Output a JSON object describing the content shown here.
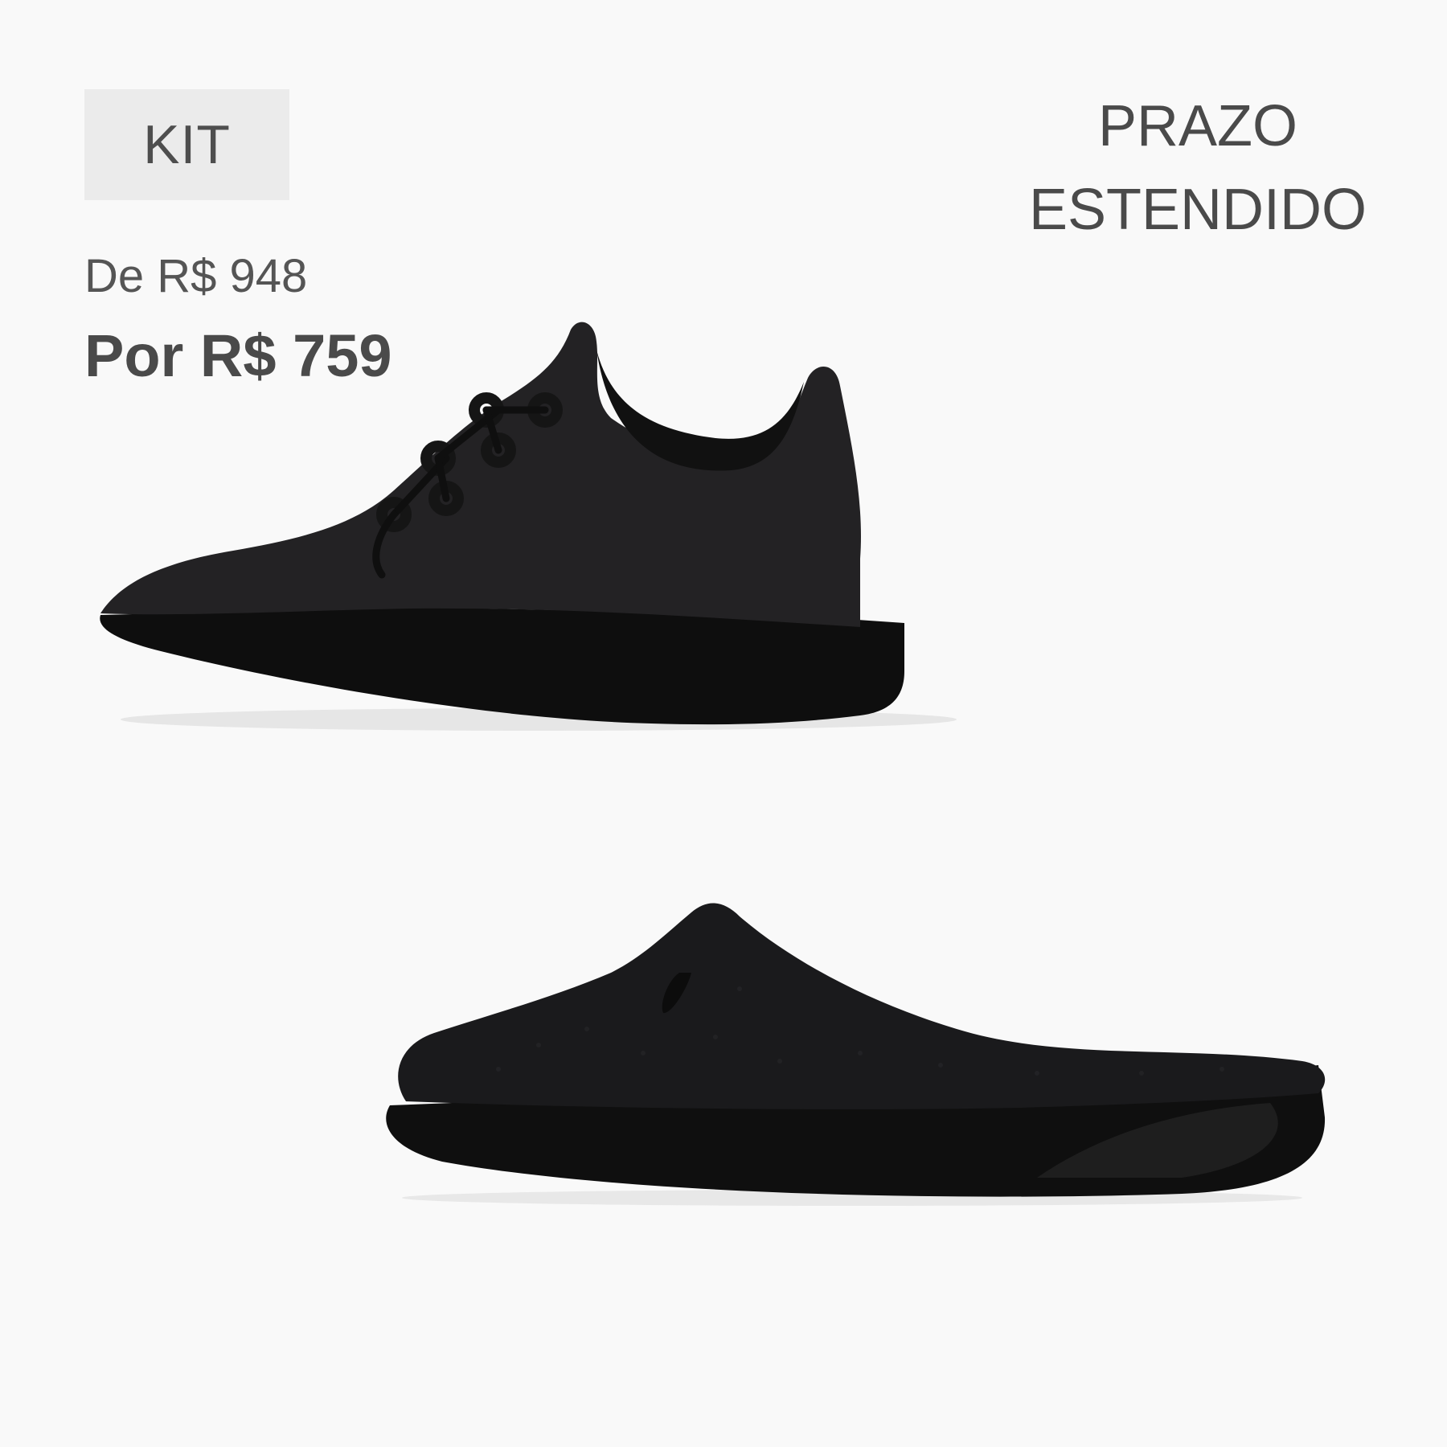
{
  "badge": {
    "label": "KIT"
  },
  "pricing": {
    "original": "De R$ 948",
    "sale": "Por R$ 759"
  },
  "promo": {
    "line1": "PRAZO",
    "line2": "ESTENDIDO"
  },
  "colors": {
    "background": "#f9f9f9",
    "badge_bg": "#ebebeb",
    "text": "#4a4a4a",
    "product": "#1c1b1c"
  },
  "products": [
    {
      "icon": "wool-sneaker-image"
    },
    {
      "icon": "knit-mule-image"
    }
  ]
}
